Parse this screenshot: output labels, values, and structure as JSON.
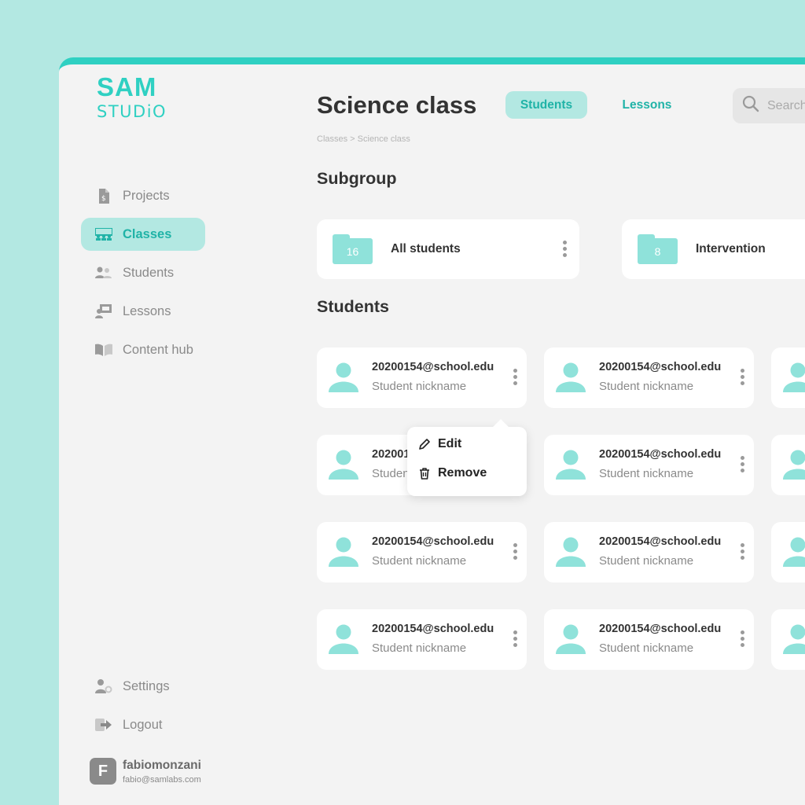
{
  "logo": {
    "top": "SAM",
    "bottom": "STUDiO"
  },
  "sidebar": {
    "items": [
      {
        "label": "Projects",
        "icon": "document-icon"
      },
      {
        "label": "Classes",
        "icon": "classroom-icon",
        "active": true
      },
      {
        "label": "Students",
        "icon": "students-icon"
      },
      {
        "label": "Lessons",
        "icon": "lesson-icon"
      },
      {
        "label": "Content hub",
        "icon": "book-icon"
      }
    ],
    "bottom": [
      {
        "label": "Settings",
        "icon": "user-settings-icon"
      },
      {
        "label": "Logout",
        "icon": "logout-icon"
      }
    ],
    "user": {
      "initial": "F",
      "name": "fabiomonzani",
      "email": "fabio@samlabs.com"
    }
  },
  "header": {
    "title": "Science class",
    "breadcrumb": "Classes > Science class",
    "tabs": [
      {
        "label": "Students",
        "active": true
      },
      {
        "label": "Lessons"
      }
    ],
    "search_placeholder": "Search"
  },
  "subgroup": {
    "title": "Subgroup",
    "cards": [
      {
        "count": "16",
        "name": "All students"
      },
      {
        "count": "8",
        "name": "Intervention"
      }
    ]
  },
  "students": {
    "title": "Students",
    "rows": [
      [
        {
          "email": "20200154@school.edu",
          "nickname": "Student nickname"
        },
        {
          "email": "20200154@school.edu",
          "nickname": "Student nickname"
        }
      ],
      [
        {
          "email": "20200154@school.edu",
          "nickname": "Student nickname"
        },
        {
          "email": "20200154@school.edu",
          "nickname": "Student nickname"
        }
      ],
      [
        {
          "email": "20200154@school.edu",
          "nickname": "Student nickname"
        },
        {
          "email": "20200154@school.edu",
          "nickname": "Student nickname"
        }
      ],
      [
        {
          "email": "20200154@school.edu",
          "nickname": "Student nickname"
        },
        {
          "email": "20200154@school.edu",
          "nickname": "Student nickname"
        }
      ]
    ]
  },
  "context_menu": {
    "edit": "Edit",
    "remove": "Remove"
  },
  "colors": {
    "accent": "#2fd0c2",
    "accent_light": "#b3e8e2",
    "accent_dark": "#20b3a7",
    "background": "#f3f3f3"
  }
}
